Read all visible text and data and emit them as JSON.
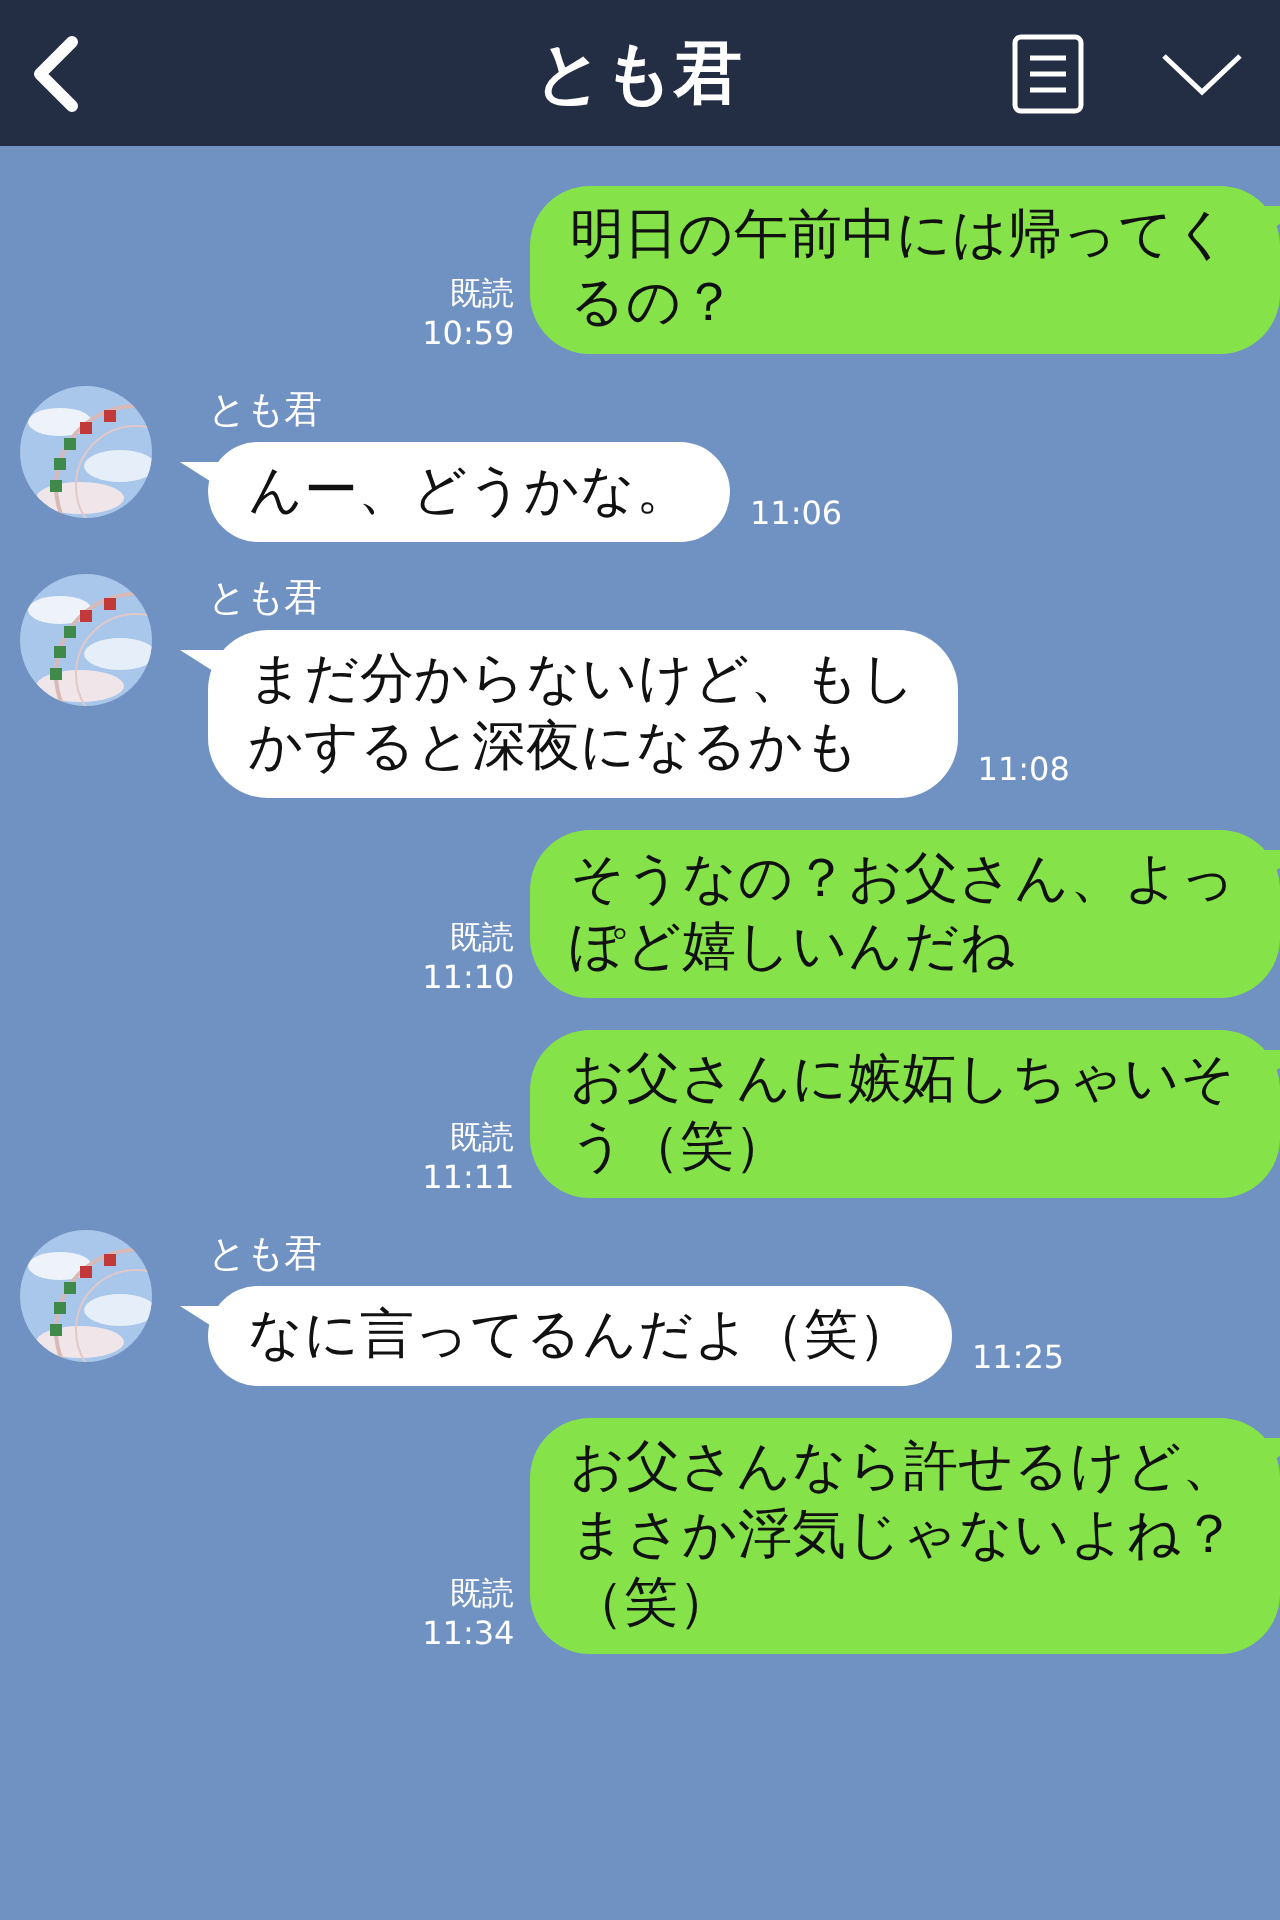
{
  "header": {
    "title": "とも君"
  },
  "messages": [
    {
      "kind": "sent",
      "text": "明日の午前中には帰ってくるの？",
      "read": "既読",
      "time": "10:59"
    },
    {
      "kind": "received",
      "sender": "とも君",
      "text": "んー、どうかな。",
      "time": "11:06"
    },
    {
      "kind": "received",
      "sender": "とも君",
      "text": "まだ分からないけど、もしかすると深夜になるかも",
      "time": "11:08"
    },
    {
      "kind": "sent",
      "text": "そうなの？お父さん、よっぽど嬉しいんだね",
      "read": "既読",
      "time": "11:10"
    },
    {
      "kind": "sent",
      "text": "お父さんに嫉妬しちゃいそう（笑）",
      "read": "既読",
      "time": "11:11"
    },
    {
      "kind": "received",
      "sender": "とも君",
      "text": "なに言ってるんだよ（笑）",
      "time": "11:25"
    },
    {
      "kind": "sent",
      "text": "お父さんなら許せるけど、まさか浮気じゃないよね？（笑）",
      "read": "既読",
      "time": "11:34"
    }
  ]
}
